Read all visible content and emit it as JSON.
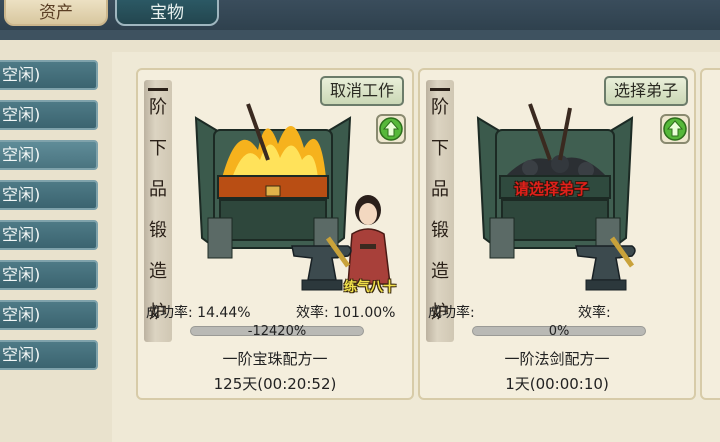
{
  "tabs": [
    {
      "label": "资产"
    },
    {
      "label": "宝物"
    }
  ],
  "sidebar": {
    "items": [
      {
        "label": "空闲)"
      },
      {
        "label": "空闲)"
      },
      {
        "label": "空闲)"
      },
      {
        "label": "空闲)"
      },
      {
        "label": "空闲)"
      },
      {
        "label": "空闲)"
      },
      {
        "label": "空闲)"
      },
      {
        "label": "空闲)"
      }
    ]
  },
  "cards": [
    {
      "title_chars": [
        "阶",
        "下",
        "品",
        "锻",
        "造",
        "炉"
      ],
      "title_prefix": "一",
      "action_label": "取消工作",
      "disciple_level": "练气八十",
      "success_label": "成功率:",
      "success_value": "14.44%",
      "efficiency_label": "效率:",
      "efficiency_value": "101.00%",
      "progress_text": "-12420%",
      "recipe": "一阶宝珠配方一",
      "time": "125天(00:20:52)",
      "burning": true
    },
    {
      "title_chars": [
        "阶",
        "下",
        "品",
        "锻",
        "造",
        "炉"
      ],
      "title_prefix": "一",
      "action_label": "选择弟子",
      "prompt": "请选择弟子",
      "success_label": "成功率:",
      "success_value": "",
      "efficiency_label": "效率:",
      "efficiency_value": "",
      "progress_text": "0%",
      "recipe": "一阶法剑配方一",
      "time": "1天(00:00:10)",
      "burning": false
    }
  ],
  "icons": {
    "upgrade": "green-up-arrow-icon",
    "colors": {
      "accent_green": "#3fae2a",
      "prompt_red": "#e0201a",
      "level_yellow": "#f1e04a"
    }
  }
}
